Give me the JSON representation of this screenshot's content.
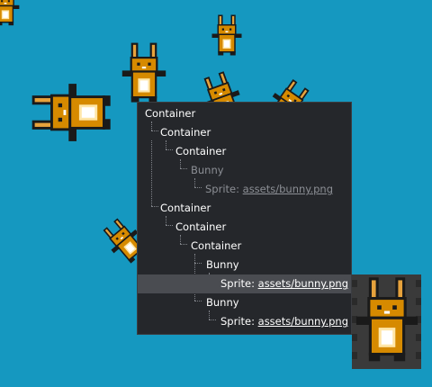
{
  "tree": {
    "nodes": [
      {
        "kind": "node",
        "label": "Container"
      },
      {
        "kind": "node",
        "label": "Container"
      },
      {
        "kind": "node",
        "label": "Container"
      },
      {
        "kind": "node",
        "label": "Bunny",
        "muted": true
      },
      {
        "kind": "sprite",
        "prefix": "Sprite: ",
        "path": "assets/bunny.png",
        "muted": true
      },
      {
        "kind": "node",
        "label": "Container"
      },
      {
        "kind": "node",
        "label": "Container"
      },
      {
        "kind": "node",
        "label": "Container"
      },
      {
        "kind": "node",
        "label": "Bunny"
      },
      {
        "kind": "sprite",
        "prefix": "Sprite: ",
        "path": "assets/bunny.png",
        "selected": true
      },
      {
        "kind": "node",
        "label": "Bunny"
      },
      {
        "kind": "sprite",
        "prefix": "Sprite: ",
        "path": "assets/bunny.png"
      }
    ]
  },
  "colors": {
    "background": "#1598c0",
    "panel": "#25272b",
    "selected_row": "#4a4c51",
    "muted_text": "#8c8f95",
    "bunny_fur": "#d68a00",
    "bunny_outline": "#1a1a1a"
  },
  "icons": [
    "bunny-sprite",
    "bunny-preview-sprite"
  ]
}
